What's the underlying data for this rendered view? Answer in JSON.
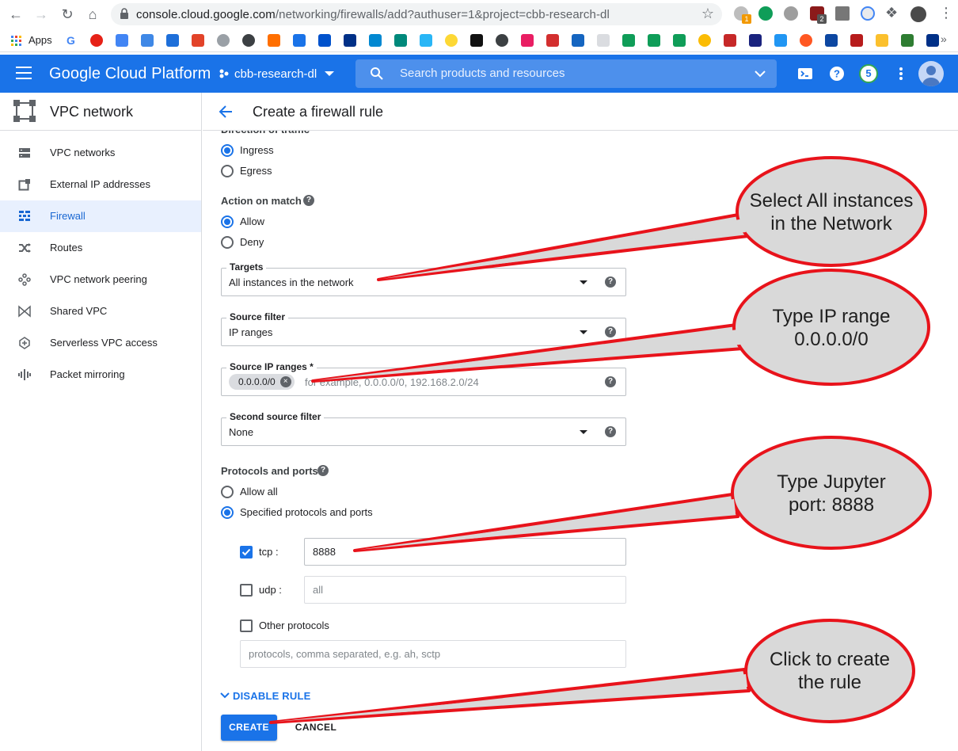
{
  "browser": {
    "url_host": "console.cloud.google.com",
    "url_path": "/networking/firewalls/add?authuser=1&project=cbb-research-dl",
    "bookmarks_apps_label": "Apps",
    "extension_badges": [
      "1",
      "2"
    ]
  },
  "header": {
    "app_title": "Google Cloud Platform",
    "project": "cbb-research-dl",
    "search_placeholder": "Search products and resources",
    "notifications_count": "5"
  },
  "sidebar": {
    "title": "VPC network",
    "items": [
      {
        "label": "VPC networks",
        "icon": "vpc-networks-icon"
      },
      {
        "label": "External IP addresses",
        "icon": "external-ip-icon"
      },
      {
        "label": "Firewall",
        "icon": "firewall-icon",
        "active": true
      },
      {
        "label": "Routes",
        "icon": "routes-icon"
      },
      {
        "label": "VPC network peering",
        "icon": "peering-icon"
      },
      {
        "label": "Shared VPC",
        "icon": "shared-vpc-icon"
      },
      {
        "label": "Serverless VPC access",
        "icon": "serverless-icon"
      },
      {
        "label": "Packet mirroring",
        "icon": "packet-mirroring-icon"
      }
    ]
  },
  "page": {
    "title": "Create a firewall rule",
    "cut_off_label": "Direction of traffic"
  },
  "form": {
    "direction": {
      "options": [
        "Ingress",
        "Egress"
      ],
      "selected": "Ingress"
    },
    "action": {
      "label": "Action on match",
      "options": [
        "Allow",
        "Deny"
      ],
      "selected": "Allow"
    },
    "targets": {
      "label": "Targets",
      "value": "All instances in the network"
    },
    "source_filter": {
      "label": "Source filter",
      "value": "IP ranges"
    },
    "source_ip_ranges": {
      "label": "Source IP ranges *",
      "chip": "0.0.0.0/0",
      "placeholder": "for example, 0.0.0.0/0, 192.168.2.0/24"
    },
    "second_source_filter": {
      "label": "Second source filter",
      "value": "None"
    },
    "protocols": {
      "label": "Protocols and ports",
      "options": [
        "Allow all",
        "Specified protocols and ports"
      ],
      "selected": "Specified protocols and ports",
      "tcp": {
        "label": "tcp :",
        "checked": true,
        "value": "8888"
      },
      "udp": {
        "label": "udp :",
        "checked": false,
        "placeholder": "all"
      },
      "other": {
        "label": "Other protocols",
        "checked": false,
        "placeholder": "protocols, comma separated, e.g. ah, sctp"
      }
    },
    "disable_rule_label": "DISABLE RULE",
    "create_label": "CREATE",
    "cancel_label": "CANCEL"
  },
  "callouts": [
    {
      "line1": "Select All instances",
      "line2": "in the Network"
    },
    {
      "line1": "Type IP range",
      "line2": "0.0.0.0/0"
    },
    {
      "line1": "Type Jupyter",
      "line2": "port: 8888"
    },
    {
      "line1": "Click to create",
      "line2": "the rule"
    }
  ],
  "colors": {
    "brand_blue": "#1a73e8",
    "active_nav_bg": "#e8f0fe",
    "callout_fill": "#d9d9d9",
    "callout_stroke": "#e8131b"
  }
}
